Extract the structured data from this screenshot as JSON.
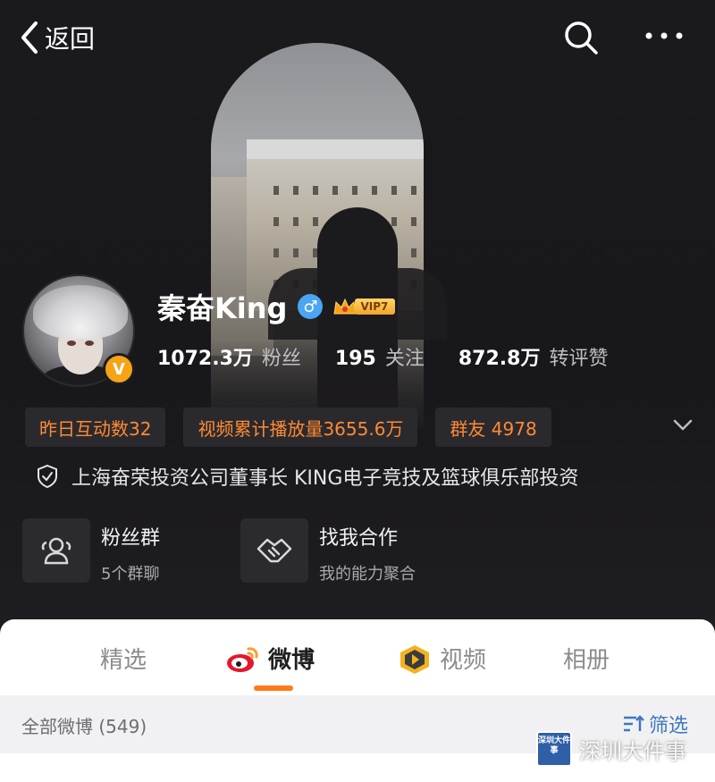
{
  "nav": {
    "back_label": "返回"
  },
  "profile": {
    "name": "秦奋King",
    "gender_symbol": "♂",
    "vip_label": "VIP7",
    "verify_badge": "V",
    "stats": [
      {
        "value": "1072.3万",
        "label": "粉丝"
      },
      {
        "value": "195",
        "label": "关注"
      },
      {
        "value": "872.8万",
        "label": "转评赞"
      }
    ]
  },
  "chips": [
    {
      "label": "昨日互动数32"
    },
    {
      "label": "视频累计播放量3655.6万"
    },
    {
      "label": "群友 4978"
    }
  ],
  "bio": "上海奋荣投资公司董事长 KING电子竞技及篮球俱乐部投资",
  "cards": [
    {
      "title": "粉丝群",
      "subtitle": "5个群聊",
      "icon": "fans-group-icon"
    },
    {
      "title": "找我合作",
      "subtitle": "我的能力聚合",
      "icon": "handshake-icon"
    }
  ],
  "tabs": [
    {
      "label": "精选"
    },
    {
      "label": "微博"
    },
    {
      "label": "视频"
    },
    {
      "label": "相册"
    }
  ],
  "active_tab": "微博",
  "feed": {
    "all_label": "全部微博 (549)",
    "filter_label": "筛选"
  },
  "watermark": {
    "logo_text": "深圳大件事",
    "text": "深圳大件事"
  },
  "colors": {
    "accent_orange": "#ff7a1a",
    "chip_text": "#ff8a33",
    "filter_blue": "#3e78bd",
    "vip_gold": "#f6a316"
  }
}
